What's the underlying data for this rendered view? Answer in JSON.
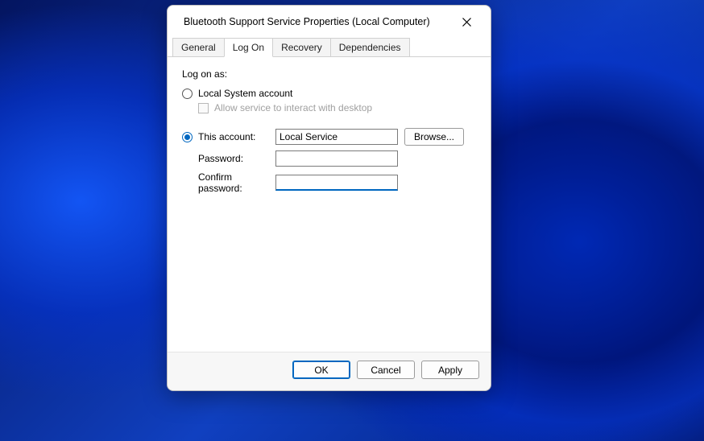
{
  "window": {
    "title": "Bluetooth Support Service Properties (Local Computer)"
  },
  "tabs": {
    "general": "General",
    "logon": "Log On",
    "recovery": "Recovery",
    "dependencies": "Dependencies",
    "active": "logon"
  },
  "logon": {
    "section_label": "Log on as:",
    "local_system_label": "Local System account",
    "allow_interact_label": "Allow service to interact with desktop",
    "this_account_label": "This account:",
    "account_value": "Local Service",
    "browse_label": "Browse...",
    "password_label": "Password:",
    "password_value": "",
    "confirm_label": "Confirm password:",
    "confirm_value": "",
    "selected": "this_account"
  },
  "buttons": {
    "ok": "OK",
    "cancel": "Cancel",
    "apply": "Apply"
  }
}
